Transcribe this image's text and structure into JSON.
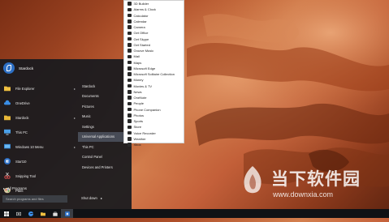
{
  "start_menu": {
    "user_name": "Stardock",
    "left_items": [
      {
        "label": "File Explorer",
        "icon": "folder-icon",
        "has_arrow": true
      },
      {
        "label": "OneDrive",
        "icon": "cloud-icon",
        "has_arrow": false
      },
      {
        "label": "Stardock",
        "icon": "stardock-icon",
        "has_arrow": true
      },
      {
        "label": "This PC",
        "icon": "computer-icon",
        "has_arrow": false
      },
      {
        "label": "Windows 10 Menu",
        "icon": "monitor-icon",
        "has_arrow": true
      },
      {
        "label": "Start10",
        "icon": "start10-icon",
        "has_arrow": false
      },
      {
        "label": "Snipping Tool",
        "icon": "scissors-icon",
        "has_arrow": false
      },
      {
        "label": "Paint",
        "icon": "paint-icon",
        "has_arrow": false
      }
    ],
    "right_items": [
      {
        "label": "Stardock",
        "highlighted": false,
        "has_arrow": false
      },
      {
        "label": "Documents",
        "highlighted": false,
        "has_arrow": false
      },
      {
        "label": "Pictures",
        "highlighted": false,
        "has_arrow": false
      },
      {
        "label": "Music",
        "highlighted": false,
        "has_arrow": false
      },
      {
        "label": "Settings",
        "highlighted": false,
        "has_arrow": false
      },
      {
        "label": "Universal Applications",
        "highlighted": true,
        "has_arrow": true
      },
      {
        "label": "This PC",
        "highlighted": false,
        "has_arrow": false
      },
      {
        "label": "Control Panel",
        "highlighted": false,
        "has_arrow": false
      },
      {
        "label": "Devices and Printers",
        "highlighted": false,
        "has_arrow": false
      }
    ],
    "all_programs": "All Programs",
    "search_placeholder": "Search programs and files",
    "shutdown_label": "Shut down",
    "shutdown_arrow": "▸",
    "arrow_glyph": "▸"
  },
  "submenu": {
    "items": [
      "3D Builder",
      "Alarms & Clock",
      "Calculator",
      "Calendar",
      "Camera",
      "Get Office",
      "Get Skype",
      "Get Started",
      "Groove Music",
      "Mail",
      "Maps",
      "Microsoft Edge",
      "Microsoft Solitaire Collection",
      "Money",
      "Movies & TV",
      "News",
      "OneNote",
      "People",
      "Phone Companion",
      "Photos",
      "Sports",
      "Store",
      "Voice Recorder",
      "Weather",
      "Xbox"
    ]
  },
  "taskbar": {
    "buttons": [
      {
        "name": "start-button-icon",
        "active": false
      },
      {
        "name": "task-view-icon",
        "active": false
      },
      {
        "name": "edge-icon",
        "active": false
      },
      {
        "name": "file-explorer-icon",
        "active": false
      },
      {
        "name": "store-icon",
        "active": false
      },
      {
        "name": "start10-icon",
        "active": true
      }
    ]
  },
  "watermark": {
    "title": "当下软件园",
    "url": "www.downxia.com"
  },
  "colors": {
    "menu_bg": "#181a1e",
    "highlight": "#5a6473",
    "taskbar": "#101215",
    "accent_blue": "#2d6fc4"
  }
}
